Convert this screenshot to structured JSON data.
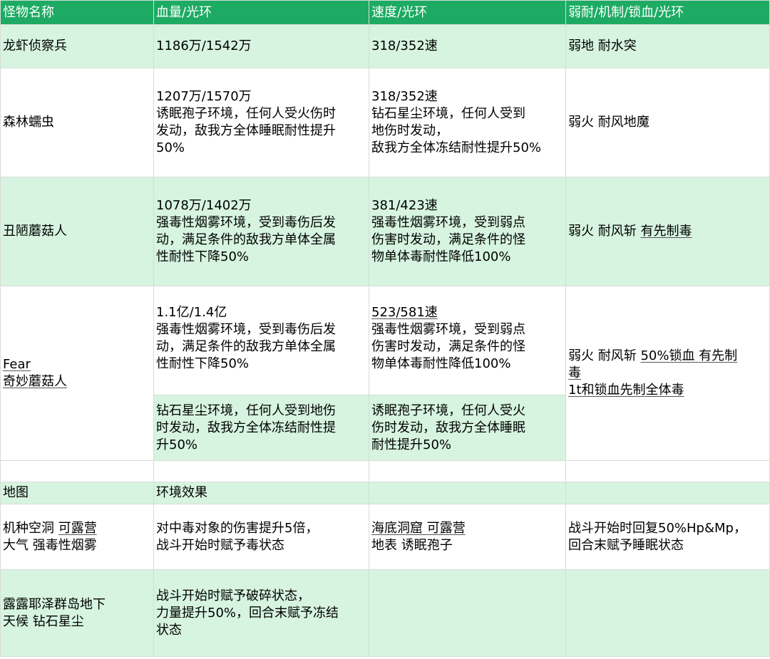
{
  "table": {
    "header": [
      "怪物名称",
      "血量/光环",
      "速度/光环",
      "弱耐/机制/锁血/光环"
    ],
    "row1": {
      "name": "龙虾侦察兵",
      "hp": "1186万/1542万",
      "speed": "318/352速",
      "weak": "弱地 耐水突"
    },
    "row2": {
      "name": "森林蠕虫",
      "hp": [
        "1207万/1570万",
        "诱眠孢子环境，任何人受火伤时",
        "发动，敌我方全体睡眠耐性提升",
        "50%"
      ],
      "speed": [
        "318/352速",
        "钻石星尘环境，任何人受到",
        "地伤时发动，",
        "敌我方全体冻结耐性提升50%"
      ],
      "weak": "弱火 耐风地魔"
    },
    "row3": {
      "name": "丑陋蘑菇人",
      "hp": [
        "1078万/1402万",
        "强毒性烟雾环境，受到毒伤后发",
        "动，满足条件的敌我方单体全属",
        "性耐性下降50%"
      ],
      "speed": [
        "381/423速",
        "强毒性烟雾环境，受到弱点",
        "伤害时发动，满足条件的怪",
        "物单体毒耐性降低100%"
      ],
      "weak_plain": "弱火 耐风斩 ",
      "weak_link": "有先制毒"
    },
    "row4": {
      "name": [
        "Fear",
        "奇妙蘑菇人"
      ],
      "hp": [
        "1.1亿/1.4亿",
        "强毒性烟雾环境，受到毒伤后发",
        "动，满足条件的敌我方单体全属",
        "性耐性下降50%"
      ],
      "speed": [
        "523/581速",
        "强毒性烟雾环境，受到弱点",
        "伤害时发动，满足条件的怪",
        "物单体毒耐性降低100%"
      ],
      "weak_line1_plain": "弱火 耐风斩 ",
      "weak_line1_link": "50%锁血 有先制",
      "weak_line2": "毒",
      "weak_line3": "1t和锁血先制全体毒",
      "hp_extra": [
        "钻石星尘环境，任何人受到地伤",
        "时发动，敌我方全体冻结耐性提",
        "升50%"
      ],
      "speed_extra": [
        "诱眠孢子环境，任何人受火",
        "伤时发动，敌我方全体睡眠",
        "耐性提升50%"
      ]
    },
    "map_header": {
      "map": "地图",
      "effect": "环境效果"
    },
    "map1": {
      "left": [
        "机种空洞 可露营",
        "大气 强毒性烟雾"
      ],
      "left_effect": [
        "对中毒对象的伤害提升5倍，",
        "战斗开始时赋予毒状态"
      ],
      "right": [
        "海底洞窟 可露营",
        "地表 诱眠孢子"
      ],
      "right_effect": [
        "战斗开始时回复50%Hp&Mp，",
        "回合末赋予睡眠状态"
      ]
    },
    "map2": {
      "left": [
        "露露耶泽群岛地下",
        "天候 钻石星尘"
      ],
      "left_effect": [
        "战斗开始时赋予破碎状态，",
        "力量提升50%，回合末赋予冻结",
        "状态"
      ]
    }
  },
  "colors": {
    "header_bg": "#1dab63",
    "row_green": "#d6f4df",
    "grid": "#d8dcd9"
  }
}
